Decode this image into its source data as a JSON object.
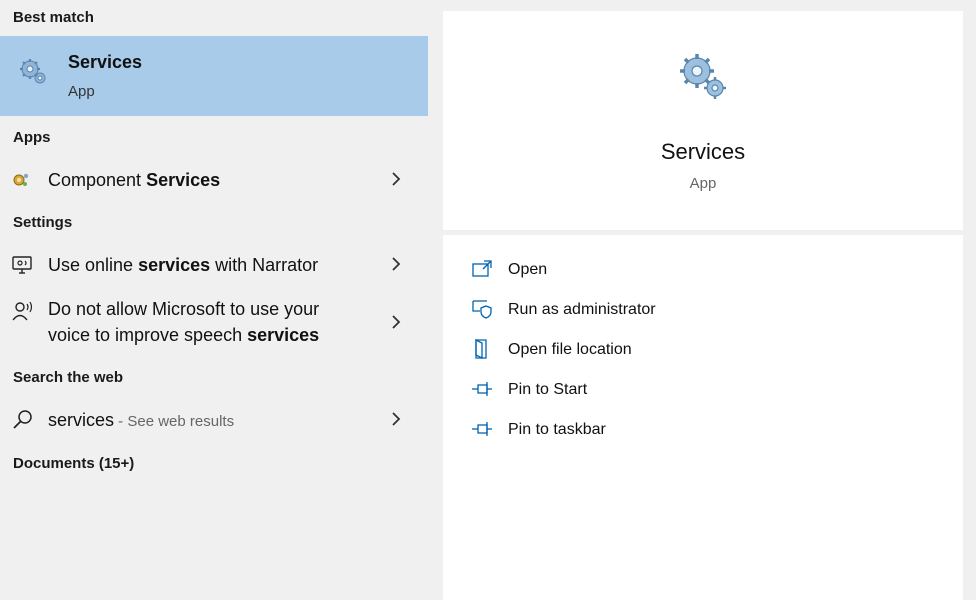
{
  "left": {
    "best_match_header": "Best match",
    "best_match": {
      "title": "Services",
      "subtitle": "App",
      "icon": "services-gears-icon"
    },
    "apps_header": "Apps",
    "apps": [
      {
        "prefix": "Component ",
        "bold": "Services",
        "suffix": "",
        "icon": "component-services-icon"
      }
    ],
    "settings_header": "Settings",
    "settings": [
      {
        "line1_pre": "Use online ",
        "line1_bold": "services",
        "line1_post": " with Narrator",
        "icon": "monitor-narrator-icon"
      },
      {
        "line1": "Do not allow Microsoft to use your",
        "line2_pre": "voice to improve speech ",
        "line2_bold": "services",
        "icon": "speech-person-icon"
      }
    ],
    "web_header": "Search the web",
    "web": {
      "query": "services",
      "hint": " - See web results",
      "icon": "search-icon"
    },
    "documents_header": "Documents (15+)"
  },
  "right": {
    "title": "Services",
    "subtitle": "App",
    "icon": "services-gears-icon",
    "actions": [
      {
        "label": "Open",
        "icon": "open-icon"
      },
      {
        "label": "Run as administrator",
        "icon": "run-as-admin-icon"
      },
      {
        "label": "Open file location",
        "icon": "file-location-icon"
      },
      {
        "label": "Pin to Start",
        "icon": "pin-icon"
      },
      {
        "label": "Pin to taskbar",
        "icon": "pin-icon"
      }
    ]
  },
  "colors": {
    "selection": "#a9cbea",
    "accent": "#0063b1",
    "panel": "#ffffff",
    "background": "#f0f0f0"
  }
}
